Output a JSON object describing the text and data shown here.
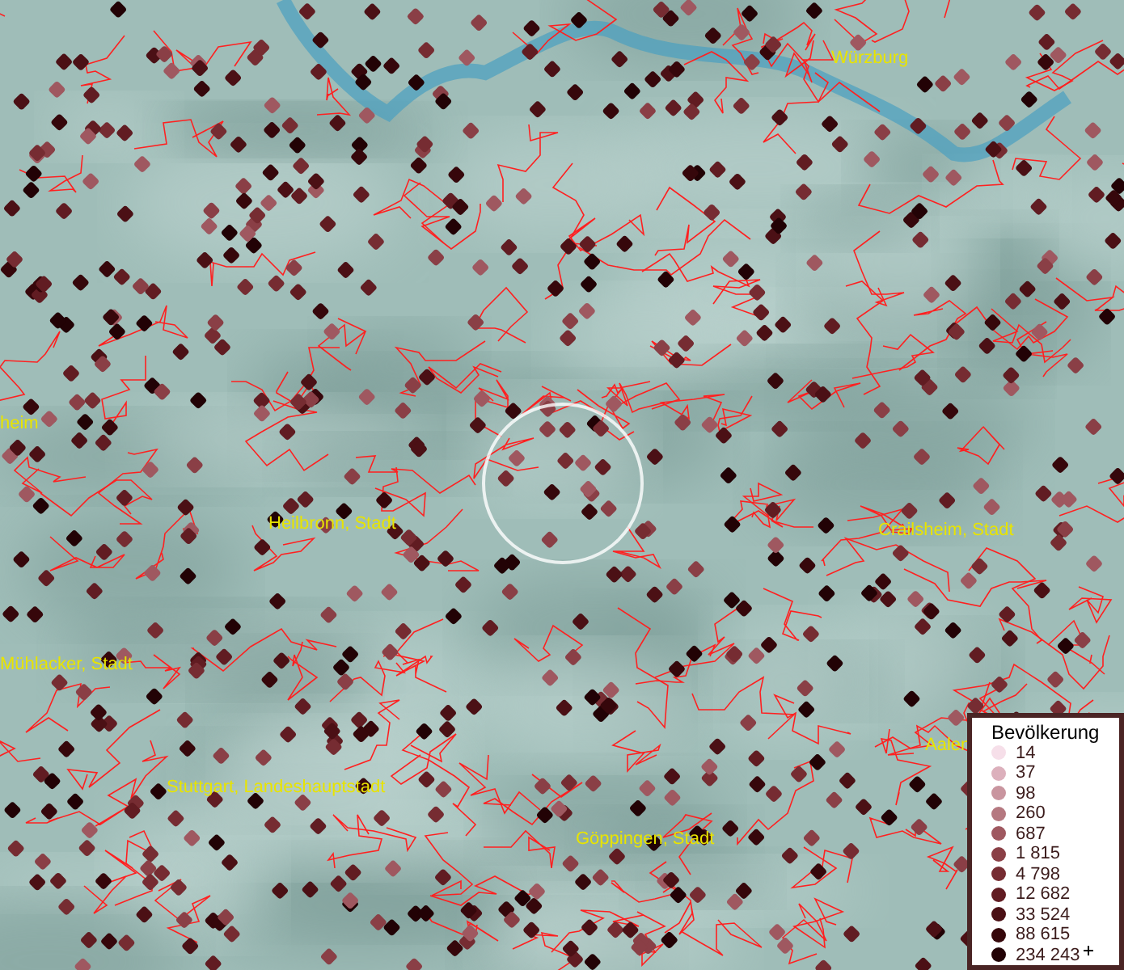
{
  "map": {
    "places": [
      {
        "name": "Würzburg"
      },
      {
        "name": "heim"
      },
      {
        "name": "Heilbronn, Stadt"
      },
      {
        "name": "Crailsheim, Stadt"
      },
      {
        "name": "Mühlacker, Stadt"
      },
      {
        "name": "Aalen"
      },
      {
        "name": "Stuttgart, Landeshauptstadt"
      },
      {
        "name": "Göppingen, Stadt"
      }
    ]
  },
  "legend": {
    "title": "Bevölkerung",
    "items": [
      {
        "label": "14",
        "color": "#f6dfe9"
      },
      {
        "label": "37",
        "color": "#dcb0bc"
      },
      {
        "label": "98",
        "color": "#c9959f"
      },
      {
        "label": "260",
        "color": "#b57880"
      },
      {
        "label": "687",
        "color": "#9f5860"
      },
      {
        "label": "1 815",
        "color": "#8a3f46"
      },
      {
        "label": "4 798",
        "color": "#762c32"
      },
      {
        "label": "12 682",
        "color": "#611c22"
      },
      {
        "label": "33 524",
        "color": "#4b1015"
      },
      {
        "label": "88 615",
        "color": "#36070b"
      },
      {
        "label": "234 243",
        "color": "#220205",
        "more": true
      }
    ]
  }
}
